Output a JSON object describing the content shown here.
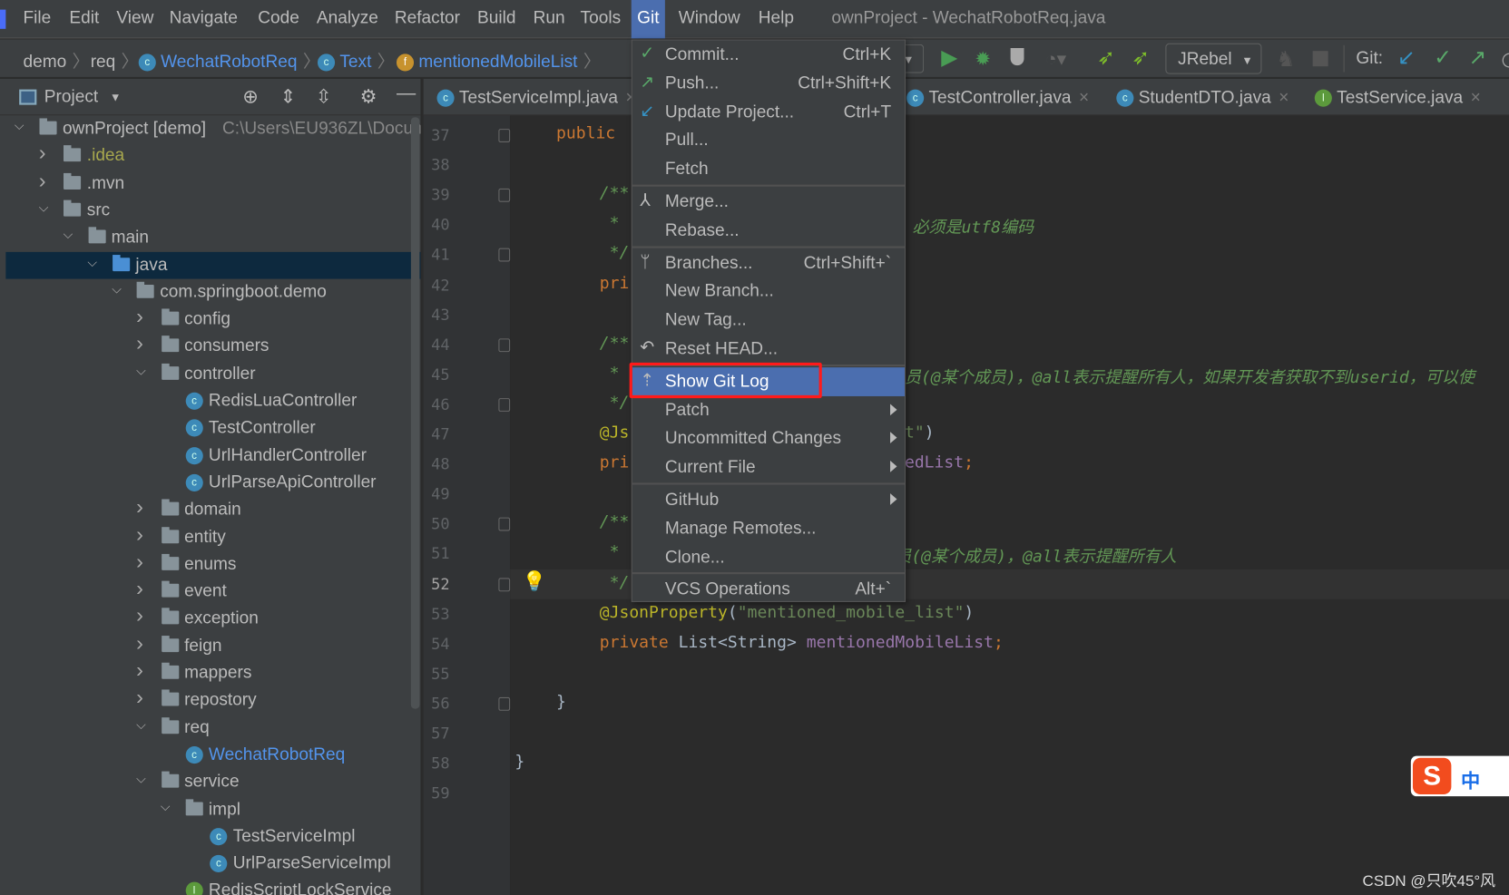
{
  "window_title": "ownProject - WechatRobotReq.java",
  "menubar": [
    "File",
    "Edit",
    "View",
    "Navigate",
    "Code",
    "Analyze",
    "Refactor",
    "Build",
    "Run",
    "Tools",
    "Git",
    "Window",
    "Help"
  ],
  "active_menu": "Git",
  "breadcrumb": [
    {
      "label": "demo",
      "icon": ""
    },
    {
      "label": "req",
      "icon": ""
    },
    {
      "label": "WechatRobotReq",
      "icon": "class-icon"
    },
    {
      "label": "Text",
      "icon": "class-icon"
    },
    {
      "label": "mentionedMobileList",
      "icon": "field-icon"
    }
  ],
  "toolbar": {
    "run_config": "JRebel",
    "git_label": "Git:"
  },
  "project_panel": {
    "title": "Project"
  },
  "tree": [
    {
      "label": "ownProject [demo]",
      "suffix": "C:\\Users\\EU936ZL\\Docum",
      "depth": 0,
      "state": "expanded",
      "type": "module"
    },
    {
      "label": ".idea",
      "depth": 1,
      "state": "collapsed",
      "type": "folder",
      "color": "#a8a84e"
    },
    {
      "label": ".mvn",
      "depth": 1,
      "state": "collapsed",
      "type": "folder"
    },
    {
      "label": "src",
      "depth": 1,
      "state": "expanded",
      "type": "folder"
    },
    {
      "label": "main",
      "depth": 2,
      "state": "expanded",
      "type": "folder"
    },
    {
      "label": "java",
      "depth": 3,
      "state": "expanded",
      "type": "source-folder",
      "selected": true
    },
    {
      "label": "com.springboot.demo",
      "depth": 4,
      "state": "expanded",
      "type": "package"
    },
    {
      "label": "config",
      "depth": 5,
      "state": "collapsed",
      "type": "package"
    },
    {
      "label": "consumers",
      "depth": 5,
      "state": "collapsed",
      "type": "package"
    },
    {
      "label": "controller",
      "depth": 5,
      "state": "expanded",
      "type": "package"
    },
    {
      "label": "RedisLuaController",
      "depth": 6,
      "type": "class"
    },
    {
      "label": "TestController",
      "depth": 6,
      "type": "class"
    },
    {
      "label": "UrlHandlerController",
      "depth": 6,
      "type": "class"
    },
    {
      "label": "UrlParseApiController",
      "depth": 6,
      "type": "class"
    },
    {
      "label": "domain",
      "depth": 5,
      "state": "collapsed",
      "type": "package"
    },
    {
      "label": "entity",
      "depth": 5,
      "state": "collapsed",
      "type": "package"
    },
    {
      "label": "enums",
      "depth": 5,
      "state": "collapsed",
      "type": "package"
    },
    {
      "label": "event",
      "depth": 5,
      "state": "collapsed",
      "type": "package"
    },
    {
      "label": "exception",
      "depth": 5,
      "state": "collapsed",
      "type": "package"
    },
    {
      "label": "feign",
      "depth": 5,
      "state": "collapsed",
      "type": "package"
    },
    {
      "label": "mappers",
      "depth": 5,
      "state": "collapsed",
      "type": "package"
    },
    {
      "label": "repostory",
      "depth": 5,
      "state": "collapsed",
      "type": "package"
    },
    {
      "label": "req",
      "depth": 5,
      "state": "expanded",
      "type": "package"
    },
    {
      "label": "WechatRobotReq",
      "depth": 6,
      "type": "class",
      "color": "#5394ec"
    },
    {
      "label": "service",
      "depth": 5,
      "state": "expanded",
      "type": "package"
    },
    {
      "label": "impl",
      "depth": 6,
      "state": "expanded",
      "type": "package"
    },
    {
      "label": "TestServiceImpl",
      "depth": 7,
      "type": "class"
    },
    {
      "label": "UrlParseServiceImpl",
      "depth": 7,
      "type": "class"
    },
    {
      "label": "RedisScriptLockService",
      "depth": 6,
      "type": "interface"
    }
  ],
  "tabs": [
    {
      "label": "TestServiceImpl.java",
      "icon": "class-icon"
    },
    {
      "label": "TestController.java",
      "icon": "class-icon"
    },
    {
      "label": "StudentDTO.java",
      "icon": "class-icon"
    },
    {
      "label": "TestService.java",
      "icon": "interface-icon"
    }
  ],
  "code": {
    "current_line": 52,
    "lines": [
      {
        "n": 37,
        "left": [
          [
            "kw",
            "public"
          ]
        ],
        "indent": 1
      },
      {
        "n": 38,
        "left": []
      },
      {
        "n": 39,
        "left": [
          [
            "cm",
            "/**"
          ]
        ],
        "indent": 2
      },
      {
        "n": 40,
        "left": [
          [
            "cm",
            " *"
          ]
        ],
        "indent": 2,
        "right": [
          [
            "cm",
            "必须是utf8编码"
          ]
        ]
      },
      {
        "n": 41,
        "left": [
          [
            "cm",
            " */"
          ]
        ],
        "indent": 2
      },
      {
        "n": 42,
        "left": [
          [
            "kw",
            "pri"
          ]
        ],
        "indent": 2
      },
      {
        "n": 43,
        "left": []
      },
      {
        "n": 44,
        "left": [
          [
            "cm",
            "/**"
          ]
        ],
        "indent": 2
      },
      {
        "n": 45,
        "left": [
          [
            "cm",
            " *"
          ]
        ],
        "indent": 2,
        "right": [
          [
            "cm",
            "员(@某个成员)，@all表示提醒所有人，如果开发者获取不到userid，可以使"
          ]
        ]
      },
      {
        "n": 46,
        "left": [
          [
            "cm",
            " */"
          ]
        ],
        "indent": 2
      },
      {
        "n": 47,
        "left": [
          [
            "an",
            "@Js"
          ]
        ],
        "indent": 2,
        "right": [
          [
            "st",
            "t\""
          ],
          [
            "pl",
            ")"
          ]
        ]
      },
      {
        "n": 48,
        "left": [
          [
            "kw",
            "pri"
          ]
        ],
        "indent": 2,
        "right": [
          [
            "fd",
            "edList"
          ],
          [
            "kw",
            ";"
          ]
        ]
      },
      {
        "n": 49,
        "left": []
      },
      {
        "n": 50,
        "left": [
          [
            "cm",
            "/**"
          ]
        ],
        "indent": 2
      },
      {
        "n": 51,
        "left": [
          [
            "cm",
            " *"
          ]
        ],
        "indent": 2,
        "right": [
          [
            "cm",
            "员(@某个成员)，@all表示提醒所有人"
          ]
        ]
      },
      {
        "n": 52,
        "left": [
          [
            "cm",
            " */"
          ]
        ],
        "indent": 2
      },
      {
        "n": 53,
        "left": [
          [
            "an",
            "@JsonProperty"
          ],
          [
            "pl",
            "("
          ],
          [
            "st",
            "\"mentioned_mobile_list\""
          ],
          [
            "pl",
            ")"
          ]
        ],
        "indent": 2
      },
      {
        "n": 54,
        "left": [
          [
            "kw",
            "private "
          ],
          [
            "pl",
            "List<String> "
          ],
          [
            "fd",
            "mentionedMobileList"
          ],
          [
            "kw",
            ";"
          ]
        ],
        "indent": 2
      },
      {
        "n": 55,
        "left": []
      },
      {
        "n": 56,
        "left": [
          [
            "pl",
            "}"
          ]
        ],
        "indent": 1
      },
      {
        "n": 57,
        "left": []
      },
      {
        "n": 58,
        "left": [
          [
            "pl",
            "}"
          ]
        ],
        "indent": 0
      },
      {
        "n": 59,
        "left": []
      }
    ]
  },
  "git_menu": [
    {
      "label": "Commit...",
      "shortcut": "Ctrl+K",
      "icon": "check-icon",
      "icon_color": "#59a869"
    },
    {
      "label": "Push...",
      "shortcut": "Ctrl+Shift+K",
      "icon": "push-arrow-icon",
      "icon_color": "#59a869"
    },
    {
      "label": "Update Project...",
      "shortcut": "Ctrl+T",
      "icon": "update-arrow-icon",
      "icon_color": "#3592c4"
    },
    {
      "label": "Pull..."
    },
    {
      "label": "Fetch",
      "separator_after": true
    },
    {
      "label": "Merge...",
      "icon": "merge-icon"
    },
    {
      "label": "Rebase...",
      "separator_after": true
    },
    {
      "label": "Branches...",
      "shortcut": "Ctrl+Shift+`",
      "icon": "branch-icon"
    },
    {
      "label": "New Branch..."
    },
    {
      "label": "New Tag..."
    },
    {
      "label": "Reset HEAD...",
      "icon": "reset-icon",
      "separator_after": true
    },
    {
      "label": "Show Git Log",
      "icon": "git-log-icon",
      "highlighted": true
    },
    {
      "label": "Patch",
      "submenu": true
    },
    {
      "label": "Uncommitted Changes",
      "submenu": true
    },
    {
      "label": "Current File",
      "submenu": true,
      "separator_after": true
    },
    {
      "label": "GitHub",
      "submenu": true
    },
    {
      "label": "Manage Remotes..."
    },
    {
      "label": "Clone...",
      "separator_after": true
    },
    {
      "label": "VCS Operations",
      "shortcut": "Alt+`"
    }
  ],
  "ime": {
    "label": "中"
  },
  "watermark": "CSDN @只吹45°风"
}
